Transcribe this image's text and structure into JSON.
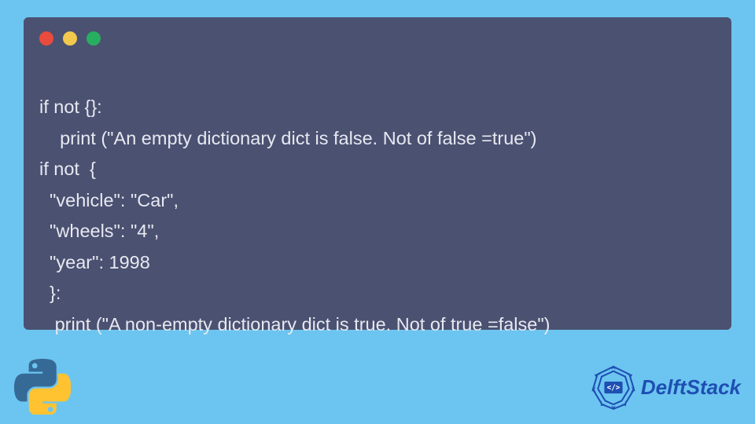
{
  "code": {
    "lines": [
      "if not {}:",
      "    print (\"An empty dictionary dict is false. Not of false =true\")",
      "if not  {",
      "  \"vehicle\": \"Car\",",
      "  \"wheels\": \"4\",",
      "  \"year\": 1998",
      "  }:",
      "   print (\"A non-empty dictionary dict is true. Not of true =false\")"
    ]
  },
  "branding": {
    "text": "DelftStack"
  },
  "colors": {
    "background": "#6cc5f0",
    "window": "#4b5171",
    "text": "#e7e9f1",
    "brand": "#1e4fb3"
  }
}
